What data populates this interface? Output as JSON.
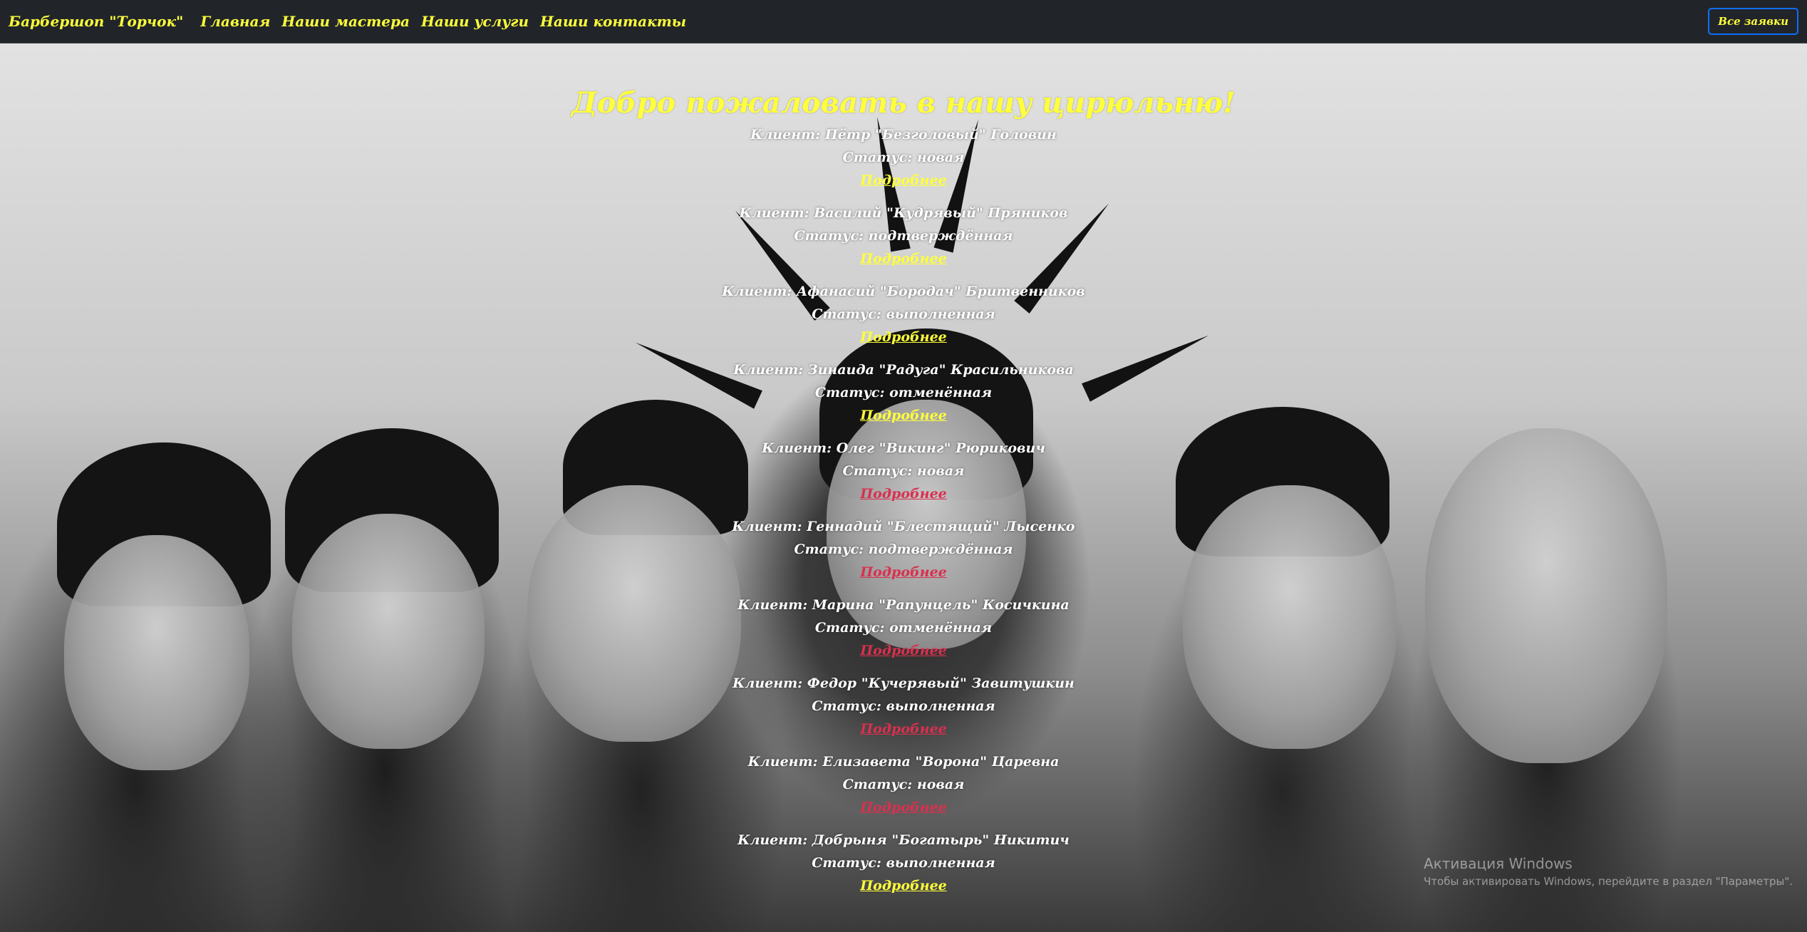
{
  "navbar": {
    "brand": "Барбершоп \"Торчок\"",
    "links": [
      "Главная",
      "Наши мастера",
      "Наши услуги",
      "Наши контакты"
    ],
    "all_requests_button": "Все заявки"
  },
  "main": {
    "title": "Добро пожаловать в нашу цирюльню!",
    "more_label": "Подробнее",
    "orders": [
      {
        "client": "Клиент: Пётр \"Безголовый\" Головин",
        "status": "Статус: новая",
        "link_color": "yellow"
      },
      {
        "client": "Клиент: Василий \"Кудрявый\" Пряников",
        "status": "Статус: подтверждённая",
        "link_color": "yellow"
      },
      {
        "client": "Клиент: Афанасий \"Бородач\" Бритвенников",
        "status": "Статус: выполненная",
        "link_color": "yellow"
      },
      {
        "client": "Клиент: Зинаида \"Радуга\" Красильникова",
        "status": "Статус: отменённая",
        "link_color": "yellow"
      },
      {
        "client": "Клиент: Олег \"Викинг\" Рюрикович",
        "status": "Статус: новая",
        "link_color": "red"
      },
      {
        "client": "Клиент: Геннадий \"Блестящий\" Лысенко",
        "status": "Статус: подтверждённая",
        "link_color": "red"
      },
      {
        "client": "Клиент: Марина \"Рапунцель\" Косичкина",
        "status": "Статус: отменённая",
        "link_color": "red"
      },
      {
        "client": "Клиент: Федор \"Кучерявый\" Завитушкин",
        "status": "Статус: выполненная",
        "link_color": "red"
      },
      {
        "client": "Клиент: Елизавета \"Ворона\" Царевна",
        "status": "Статус: новая",
        "link_color": "red"
      },
      {
        "client": "Клиент: Добрыня \"Богатырь\" Никитич",
        "status": "Статус: выполненная",
        "link_color": "yellow"
      }
    ]
  },
  "watermark": {
    "title": "Активация Windows",
    "subtitle": "Чтобы активировать Windows, перейдите в раздел \"Параметры\"."
  },
  "colors": {
    "navbar_bg": "#212529",
    "accent_yellow": "#ffff3b",
    "accent_red": "#d9304f",
    "button_border": "#0d6efd"
  }
}
